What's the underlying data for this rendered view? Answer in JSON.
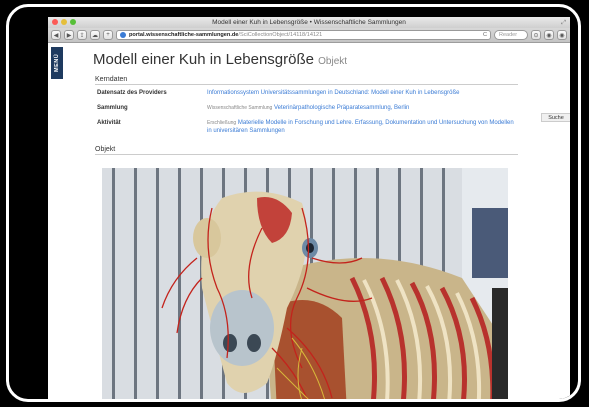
{
  "window": {
    "title": "Modell einer Kuh in Lebensgröße • Wissenschaftliche Sammlungen",
    "url_host": "portal.wissenschaftliche-sammlungen.de",
    "url_path": "/SciCollectionObject/14118/14121",
    "reload_symbol": "C",
    "search_placeholder": "Reader"
  },
  "nav": {
    "menu_label": "MENÜ",
    "search_label": "Suche"
  },
  "page": {
    "title": "Modell einer Kuh in Lebensgröße",
    "title_suffix": "Objekt",
    "kerndaten_heading": "Kerndaten",
    "objekt_heading": "Objekt",
    "rows": [
      {
        "label": "Datensatz des Providers",
        "tag": "",
        "value": "Informationssystem Universitätssammlungen in Deutschland: Modell einer Kuh in Lebensgröße"
      },
      {
        "label": "Sammlung",
        "tag": "Wissenschaftliche Sammlung",
        "value": "Veterinärpathologische Präparatesammlung, Berlin"
      },
      {
        "label": "Aktivität",
        "tag": "Erschließung",
        "value": "Materielle Modelle in Forschung und Lehre. Erfassung, Dokumentation und Untersuchung von Modellen in universitären Sammlungen"
      }
    ]
  },
  "colors": {
    "link": "#3a7bd5",
    "menu_tab": "#1e3a5f"
  },
  "icons": [
    "back-icon",
    "forward-icon",
    "share-icon",
    "cloud-icon",
    "add-tab-icon",
    "lock-icon",
    "reload-icon",
    "downloads-icon",
    "extension-icon"
  ]
}
